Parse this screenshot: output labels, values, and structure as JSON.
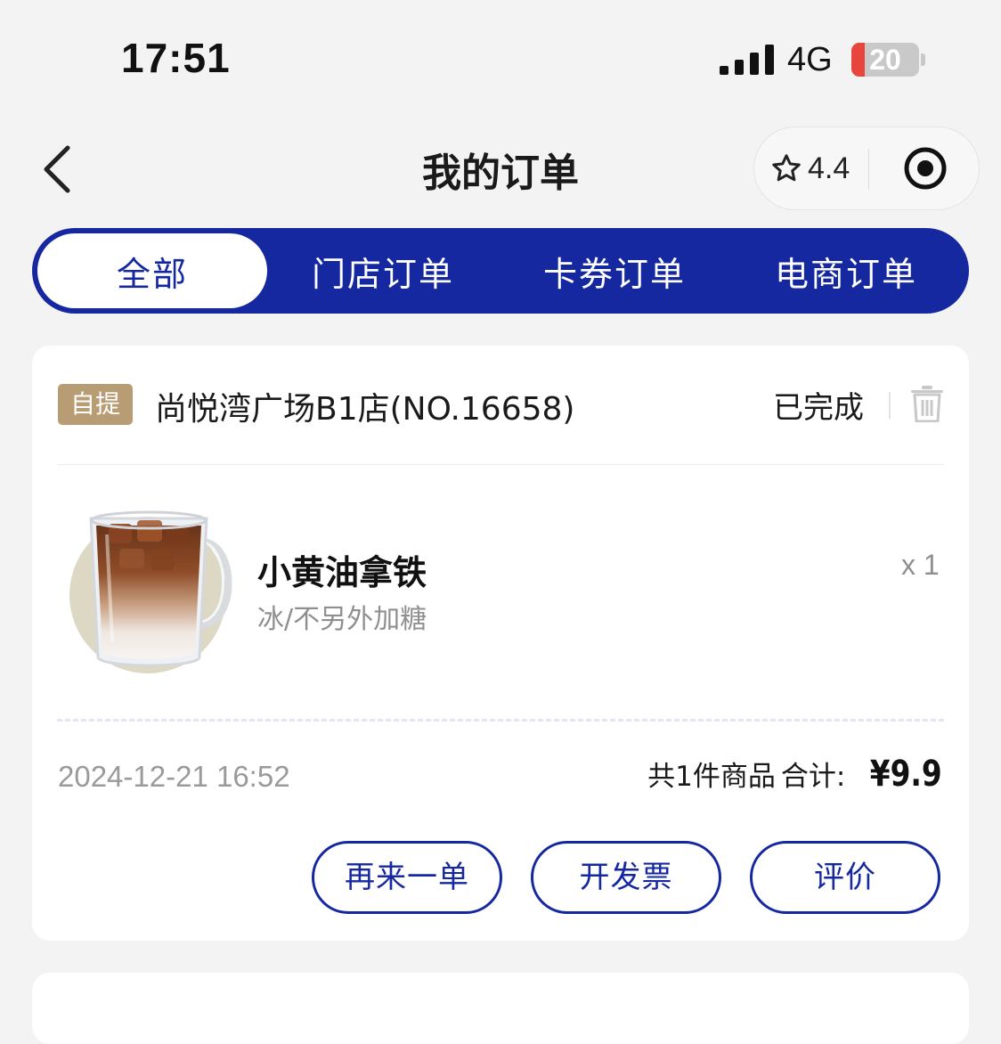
{
  "status_bar": {
    "time": "17:51",
    "network": "4G",
    "battery": "20",
    "battery_level": 0.2
  },
  "nav": {
    "title": "我的订单",
    "rating": "4.4"
  },
  "tabs": [
    {
      "label": "全部",
      "active": true
    },
    {
      "label": "门店订单",
      "active": false
    },
    {
      "label": "卡券订单",
      "active": false
    },
    {
      "label": "电商订单",
      "active": false
    }
  ],
  "order": {
    "type_badge": "自提",
    "store": "尚悦湾广场B1店(NO.16658)",
    "status": "已完成",
    "product": {
      "name": "小黄油拿铁",
      "spec": "冰/不另外加糖",
      "qty": "x 1"
    },
    "time": "2024-12-21 16:52",
    "item_count": "共1件商品",
    "total_label": "合计:",
    "total": "¥9.9",
    "actions": [
      "再来一单",
      "开发票",
      "评价"
    ]
  },
  "colors": {
    "brand": "#1628a0",
    "badge": "#b89c74",
    "battery_low": "#e8463d"
  }
}
